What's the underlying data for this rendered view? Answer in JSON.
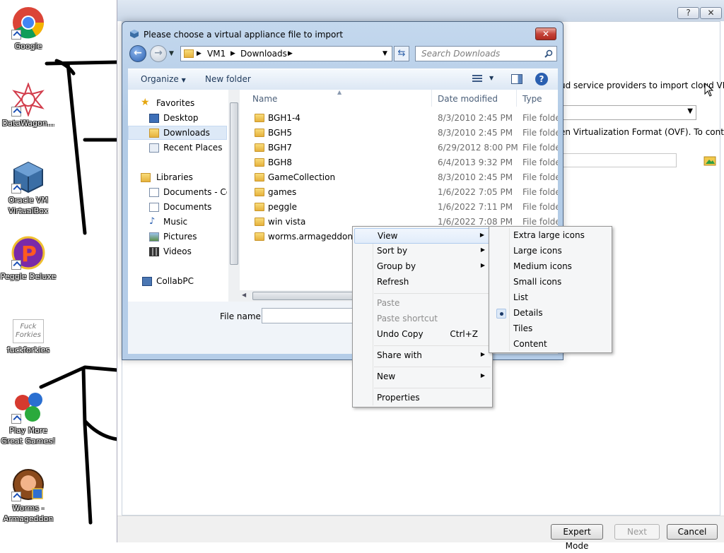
{
  "desktop": {
    "icons": [
      {
        "label": "Google"
      },
      {
        "label": "DataWagon..."
      },
      {
        "label": "Oracle VM VirtualBox"
      },
      {
        "label": "Peggle Deluxe"
      },
      {
        "label": "fuckforkies",
        "art_text": "Fuck Forkies"
      },
      {
        "label": "Play More Great Games!"
      },
      {
        "label": "Worms - Armageddon"
      }
    ]
  },
  "wizard": {
    "help_btn": "?",
    "close_btn": "✕",
    "text_cloud": "ud service providers to import cloud VM",
    "text_ovf": "en Virtualization Format (OVF). To continue,",
    "buttons": {
      "expert": "Expert Mode",
      "next": "Next",
      "cancel": "Cancel"
    }
  },
  "dialog": {
    "title": "Please choose a virtual appliance file to import",
    "close_label": "✕",
    "address": {
      "segments": [
        "VM1",
        "Downloads"
      ]
    },
    "search_placeholder": "Search Downloads",
    "toolbar": {
      "organize": "Organize",
      "new_folder": "New folder"
    },
    "nav": {
      "favorites": "Favorites",
      "desktop": "Desktop",
      "downloads": "Downloads",
      "recent": "Recent Places",
      "libraries": "Libraries",
      "documents_cop": "Documents - Cop",
      "documents": "Documents",
      "music": "Music",
      "pictures": "Pictures",
      "videos": "Videos",
      "computer": "CollabPC"
    },
    "columns": {
      "name": "Name",
      "date": "Date modified",
      "type": "Type"
    },
    "rows": [
      {
        "name": "BGH1-4",
        "date": "8/3/2010 2:45 PM",
        "type": "File folder"
      },
      {
        "name": "BGH5",
        "date": "8/3/2010 2:45 PM",
        "type": "File folder"
      },
      {
        "name": "BGH7",
        "date": "6/29/2012 8:00 PM",
        "type": "File folder"
      },
      {
        "name": "BGH8",
        "date": "6/4/2013 9:32 PM",
        "type": "File folder"
      },
      {
        "name": "GameCollection",
        "date": "8/3/2010 2:45 PM",
        "type": "File folder"
      },
      {
        "name": "games",
        "date": "1/6/2022 7:05 PM",
        "type": "File folder"
      },
      {
        "name": "peggle",
        "date": "1/6/2022 7:11 PM",
        "type": "File folder"
      },
      {
        "name": "win vista",
        "date": "1/6/2022 7:08 PM",
        "type": "File folder"
      },
      {
        "name": "worms.armageddon",
        "date": "",
        "type": ""
      }
    ],
    "file_name_label": "File name:"
  },
  "context_menu": {
    "view": "View",
    "sort_by": "Sort by",
    "group_by": "Group by",
    "refresh": "Refresh",
    "paste": "Paste",
    "paste_shortcut": "Paste shortcut",
    "undo_copy": "Undo Copy",
    "undo_shortcut": "Ctrl+Z",
    "share_with": "Share with",
    "new": "New",
    "properties": "Properties"
  },
  "view_submenu": {
    "extra_large": "Extra large icons",
    "large": "Large icons",
    "medium": "Medium icons",
    "small": "Small icons",
    "list": "List",
    "details": "Details",
    "tiles": "Tiles",
    "content": "Content",
    "selected": "Details"
  },
  "colors": {
    "dialog_frame": "#b5cde8",
    "selection": "#dde9f7",
    "menu_highlight": "#e1ecfa"
  }
}
